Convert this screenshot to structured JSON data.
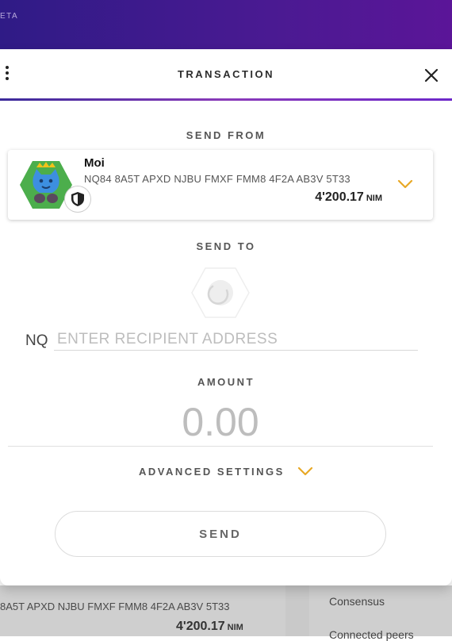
{
  "top_bar": {
    "beta_label": "ETA"
  },
  "header": {
    "title": "TRANSACTION"
  },
  "send_from": {
    "label": "SEND FROM",
    "account": {
      "name": "Moi",
      "address": "NQ84 8A5T APXD NJBU FMXF FMM8 4F2A AB3V 5T33",
      "balance": "4'200.17",
      "unit": "NIM"
    }
  },
  "send_to": {
    "label": "SEND TO",
    "prefix": "NQ",
    "placeholder": "ENTER RECIPIENT ADDRESS"
  },
  "amount": {
    "label": "AMOUNT",
    "placeholder": "0.00"
  },
  "advanced": {
    "label": "ADVANCED SETTINGS"
  },
  "send_button": {
    "label": "SEND"
  },
  "background": {
    "address": "8A5T APXD NJBU FMXF FMM8 4F2A AB3V 5T33",
    "balance": "4'200.17",
    "unit": "NIM",
    "consensus_label": "Consensus",
    "peers_label": "Connected peers"
  },
  "colors": {
    "accent": "#e8a825",
    "header_gradient_start": "#2f1b86",
    "header_gradient_end": "#5b1598",
    "identicon_hex": "#4cae4c",
    "identicon_face": "#3d8fe0"
  },
  "icons": [
    "menu-dots-icon",
    "close-icon",
    "identicon",
    "shield-icon",
    "chevron-down-icon",
    "hexagon-placeholder-icon"
  ]
}
